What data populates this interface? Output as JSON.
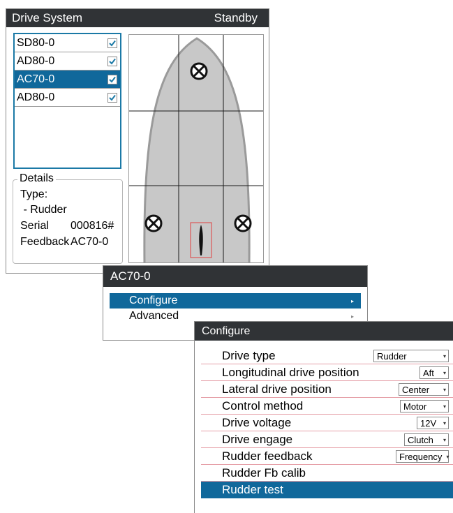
{
  "drive_window": {
    "title": "Drive System",
    "status": "Standby",
    "devices": [
      {
        "name": "SD80-0",
        "checked": true,
        "selected": false
      },
      {
        "name": "AD80-0",
        "checked": true,
        "selected": false
      },
      {
        "name": "AC70-0",
        "checked": true,
        "selected": true
      },
      {
        "name": "AD80-0",
        "checked": true,
        "selected": false
      }
    ],
    "details": {
      "legend": "Details",
      "type_label": "Type:",
      "type_value": " - Rudder",
      "serial_label": "Serial",
      "serial_value": "000816#",
      "feedback_label": "Feedback",
      "feedback_value": "AC70-0"
    }
  },
  "ac_menu": {
    "title": "AC70-0",
    "items": [
      {
        "label": "Configure",
        "arrow": "▸"
      },
      {
        "label": "Advanced",
        "arrow": "▸"
      }
    ]
  },
  "configure_dialog": {
    "title": "Configure",
    "rows": [
      {
        "label": "Drive type",
        "value": "Rudder"
      },
      {
        "label": "Longitudinal drive position",
        "value": "Aft"
      },
      {
        "label": "Lateral drive position",
        "value": "Center"
      },
      {
        "label": "Control method",
        "value": "Motor"
      },
      {
        "label": "Drive voltage",
        "value": "12V"
      },
      {
        "label": "Drive engage",
        "value": "Clutch"
      },
      {
        "label": "Rudder feedback",
        "value": "Frequency"
      },
      {
        "label": "Rudder Fb calib"
      },
      {
        "label": "Rudder test"
      }
    ],
    "caret": "▾"
  },
  "colors": {
    "titlebar": "#303336",
    "selection": "#10689b",
    "list_border": "#1b79a6",
    "hull_fill": "#c8c8c8",
    "rudder_box": "#e04040",
    "row_divider": "#e6a0a8"
  },
  "icons": {
    "checkbox": "check-icon",
    "thruster": "thruster-icon",
    "rudder": "rudder-icon",
    "submenu": "chevron-right-icon",
    "dropdown": "chevron-down-icon"
  }
}
